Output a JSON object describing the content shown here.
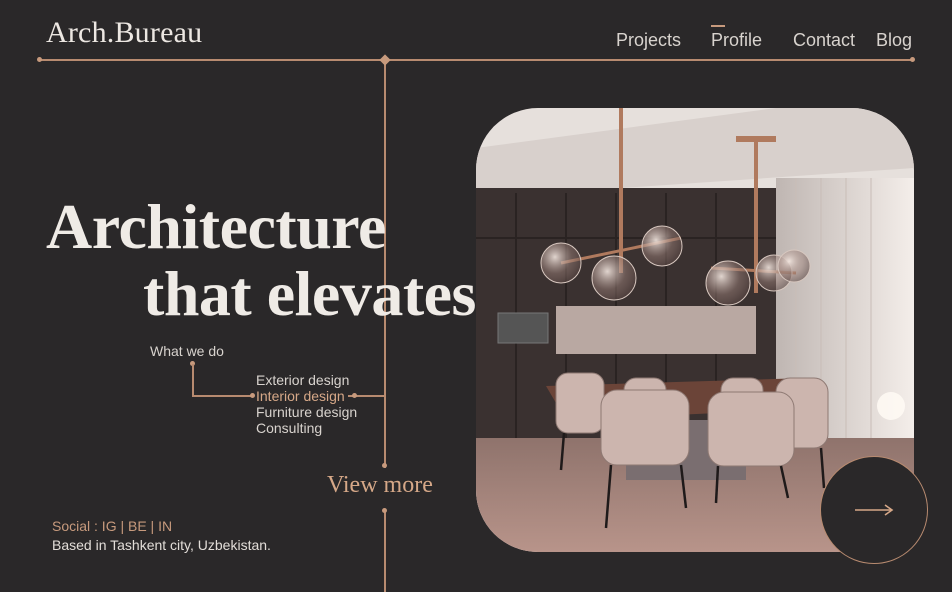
{
  "brand": {
    "name": "Arch.Bureau"
  },
  "nav": {
    "items": [
      {
        "label": "Projects"
      },
      {
        "label": "Profile",
        "active": true
      },
      {
        "label": "Contact"
      },
      {
        "label": "Blog"
      }
    ]
  },
  "hero": {
    "headline_line1": "Architecture",
    "headline_line2": "that elevates",
    "image_description_icon": "interior-dining-room-image"
  },
  "services": {
    "heading": "What we do",
    "items": [
      "Exterior design",
      "Interior design",
      "Furniture design",
      "Consulting"
    ],
    "active_index": 1
  },
  "cta": {
    "view_more": "View more",
    "next_icon": "arrow-right-icon"
  },
  "footer": {
    "social": "Social : IG | BE | IN",
    "location": "Based in Tashkent city, Uzbekistan."
  },
  "colors": {
    "background": "#2a2829",
    "accent": "#c79a7d",
    "text": "#e8e4e0"
  }
}
